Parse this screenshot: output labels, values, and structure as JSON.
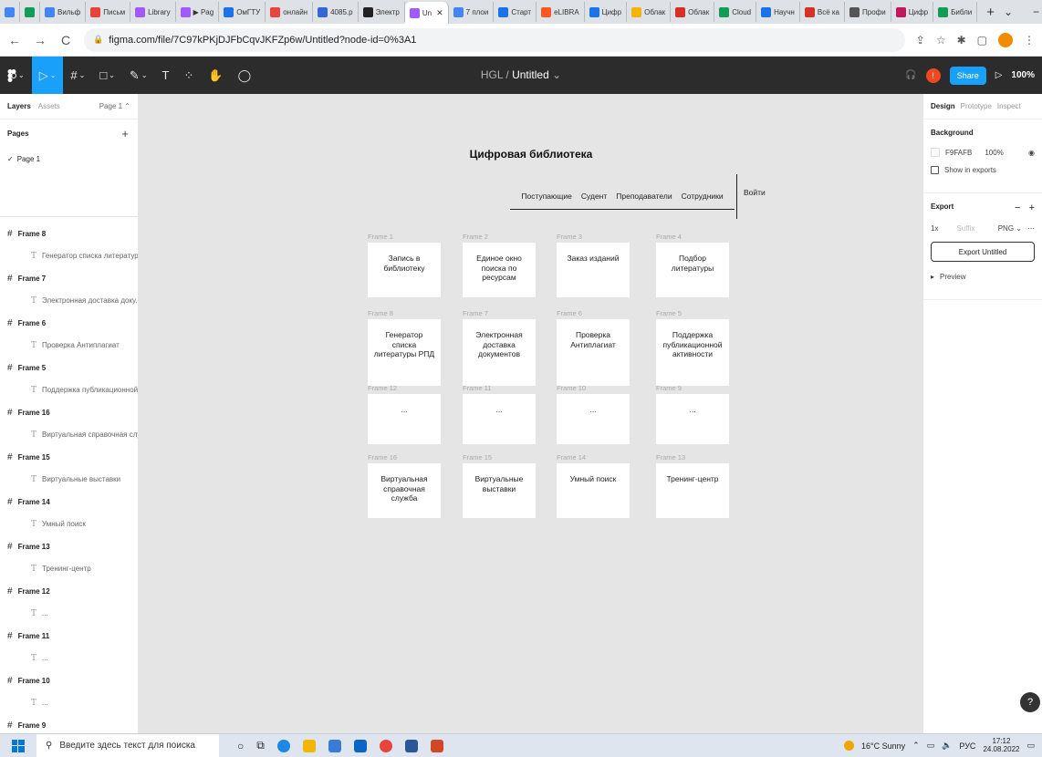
{
  "browser": {
    "tabs": [
      {
        "label": "Вильф",
        "color": "#4285f4"
      },
      {
        "label": "Письм",
        "color": "#ea4335"
      },
      {
        "label": "Library",
        "color": "#a259ff"
      },
      {
        "label": "▶ Pag",
        "color": "#a259ff"
      },
      {
        "label": "ОмГТУ",
        "color": "#1a73e8"
      },
      {
        "label": "онлайн",
        "color": "#e8453c"
      },
      {
        "label": "4085.p",
        "color": "#3367d6"
      },
      {
        "label": "Электр",
        "color": "#222222"
      },
      {
        "label": "Un",
        "color": "#a259ff",
        "active": true
      },
      {
        "label": "7 плои",
        "color": "#4285f4"
      },
      {
        "label": "Старт",
        "color": "#1a73e8"
      },
      {
        "label": "eLIBRA",
        "color": "#ff5722"
      },
      {
        "label": "Цифр",
        "color": "#1a73e8"
      },
      {
        "label": "Облак",
        "color": "#f4b400"
      },
      {
        "label": "Облак",
        "color": "#d93025"
      },
      {
        "label": "Cloud",
        "color": "#0f9d58"
      },
      {
        "label": "Научн",
        "color": "#1a73e8"
      },
      {
        "label": "Всё ка",
        "color": "#d93025"
      },
      {
        "label": "Профи",
        "color": "#555555"
      },
      {
        "label": "Цифр",
        "color": "#c2185b"
      },
      {
        "label": "Библи",
        "color": "#0f9d58"
      }
    ],
    "url": "figma.com/file/7C97kPKjDJFbCqvJKFZp6w/Untitled?node-id=0%3A1"
  },
  "figma": {
    "project": "HGL",
    "separator": "/",
    "file_name": "Untitled",
    "share_label": "Share",
    "zoom": "100%",
    "avatar_initial": "!"
  },
  "left_panel": {
    "tab_layers": "Layers",
    "tab_assets": "Assets",
    "page_selector": "Page 1",
    "pages_title": "Pages",
    "page_current": "Page 1",
    "layers": [
      {
        "frame": "Frame 8",
        "text": "Генератор списка литератур..."
      },
      {
        "frame": "Frame 7",
        "text": "Электронная доставка доку..."
      },
      {
        "frame": "Frame 6",
        "text": "Проверка Антиплагиат"
      },
      {
        "frame": "Frame 5",
        "text": "Поддержка публикационной..."
      },
      {
        "frame": "Frame 16",
        "text": "Виртуальная справочная слу..."
      },
      {
        "frame": "Frame 15",
        "text": "Виртуальные выставки"
      },
      {
        "frame": "Frame 14",
        "text": "Умный поиск"
      },
      {
        "frame": "Frame 13",
        "text": "Тренинг-центр"
      },
      {
        "frame": "Frame 12",
        "text": "..."
      },
      {
        "frame": "Frame 11",
        "text": "..."
      },
      {
        "frame": "Frame 10",
        "text": "..."
      },
      {
        "frame": "Frame 9",
        "text": "..."
      }
    ]
  },
  "canvas": {
    "title": "Цифровая библиотека",
    "nav": [
      "Поступающие",
      "Судент",
      "Преподаватели",
      "Сотрудники"
    ],
    "login": "Войти",
    "rows": [
      [
        {
          "label": "Frame 1",
          "text": "Запись в библиотеку"
        },
        {
          "label": "Frame 2",
          "text": "Единое окно поиска по ресурсам"
        },
        {
          "label": "Frame 3",
          "text": "Заказ изданий"
        },
        {
          "label": "Frame 4",
          "text": "Подбор литературы"
        }
      ],
      [
        {
          "label": "Frame 8",
          "text": "Генератор списка литературы РПД"
        },
        {
          "label": "Frame 7",
          "text": "Электронная доставка документов"
        },
        {
          "label": "Frame 6",
          "text": "Проверка Антиплагиат"
        },
        {
          "label": "Frame 5",
          "text": "Поддержка публикационной активности"
        }
      ],
      [
        {
          "label": "Frame 12",
          "text": "..."
        },
        {
          "label": "Frame 11",
          "text": "..."
        },
        {
          "label": "Frame 10",
          "text": "..."
        },
        {
          "label": "Frame 9",
          "text": "..."
        }
      ],
      [
        {
          "label": "Frame 16",
          "text": "Виртуальная справочная служба"
        },
        {
          "label": "Frame 15",
          "text": "Виртуальные выставки"
        },
        {
          "label": "Frame 14",
          "text": "Умный поиск"
        },
        {
          "label": "Frame 13",
          "text": "Тренинг-центр"
        }
      ]
    ]
  },
  "right_panel": {
    "tab_design": "Design",
    "tab_prototype": "Prototype",
    "tab_inspect": "Inspect",
    "background_title": "Background",
    "bg_hex": "F9FAFB",
    "bg_opacity": "100%",
    "show_in_exports": "Show in exports",
    "export_title": "Export",
    "export_scale": "1x",
    "export_suffix": "Suffix",
    "export_format": "PNG",
    "export_button": "Export Untitled",
    "preview": "Preview",
    "help": "?"
  },
  "taskbar": {
    "search_placeholder": "Введите здесь текст для поиска",
    "weather": "16°C Sunny",
    "lang": "РУС",
    "time": "17:12",
    "date": "24.08.2022"
  },
  "colors": {
    "figma_blue": "#18a0fb",
    "toolbar_bg": "#2c2c2c",
    "canvas_bg": "#e5e5e5"
  }
}
